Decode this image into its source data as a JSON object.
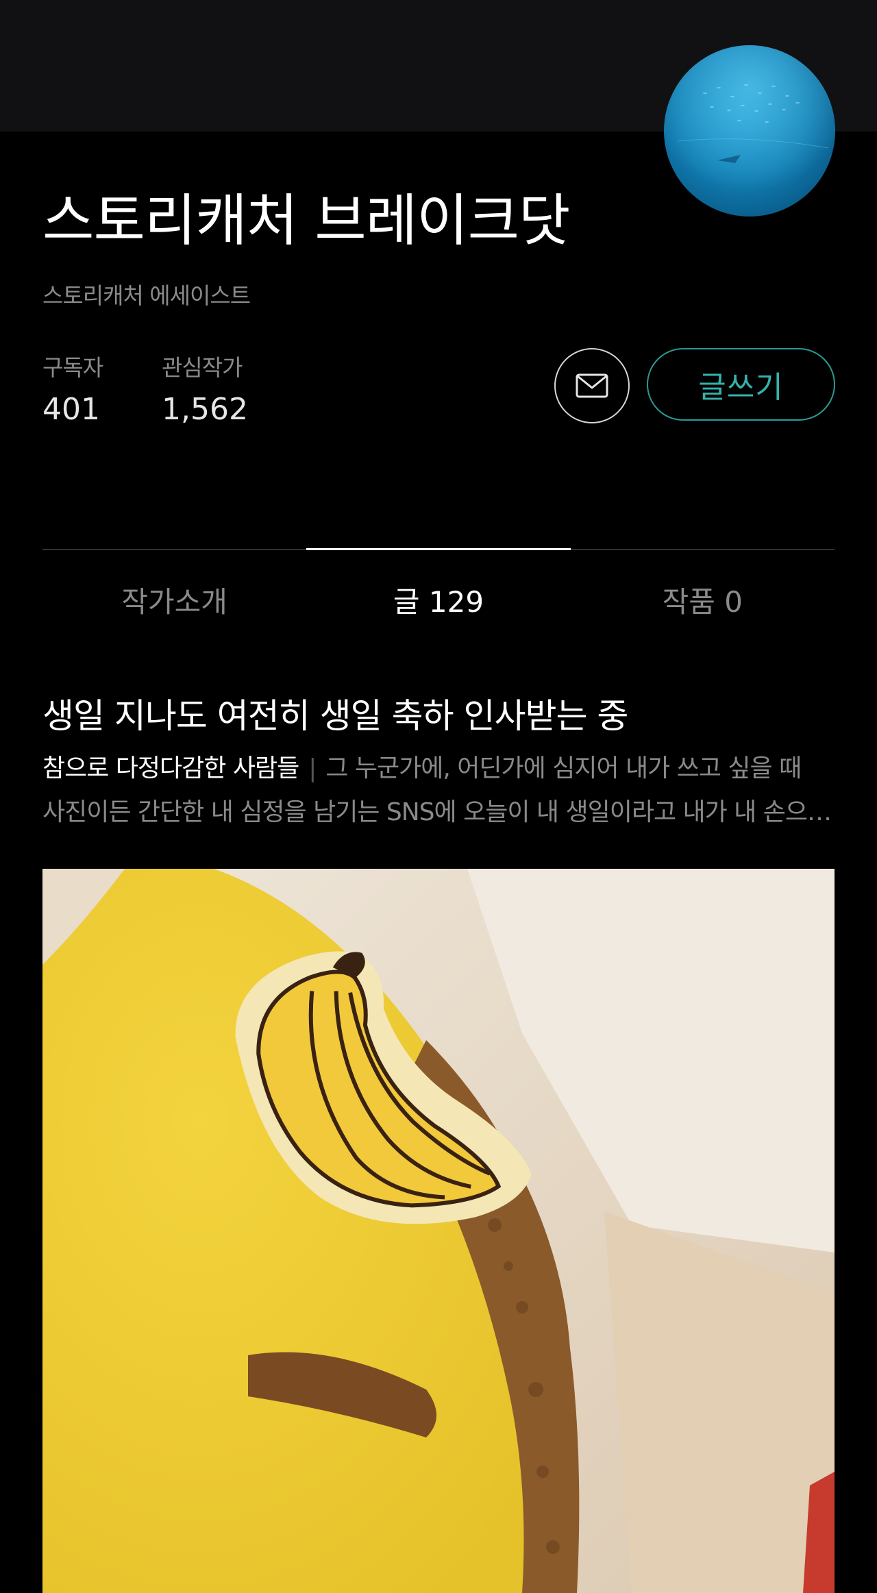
{
  "profile": {
    "name": "스토리캐처 브레이크닷",
    "role": "스토리캐처 에세이스트",
    "avatar_icon": "ocean-photo-avatar"
  },
  "stats": {
    "subscribers_label": "구독자",
    "subscribers_value": "401",
    "interest_label": "관심작가",
    "interest_value": "1,562"
  },
  "actions": {
    "mail_icon": "envelope-icon",
    "write_label": "글쓰기",
    "accent_color": "#35b2ab"
  },
  "tabs": [
    {
      "label": "작가소개",
      "active": false
    },
    {
      "label": "글 129",
      "active": true
    },
    {
      "label": "작품 0",
      "active": false
    }
  ],
  "post": {
    "title": "생일 지나도 여전히 생일 축하 인사받는 중",
    "subtitle": "참으로 다정다감한 사람들",
    "separator": "|",
    "excerpt_line1": "그 누군가에, 어딘가에 심지어 내가 쓰고 싶을 때",
    "excerpt_line2": "사진이든 간단한 내 심정을 남기는 SNS에 오늘이 내 생일이라고 내가 내 손으…",
    "image_icon": "banana-cake-photo"
  }
}
